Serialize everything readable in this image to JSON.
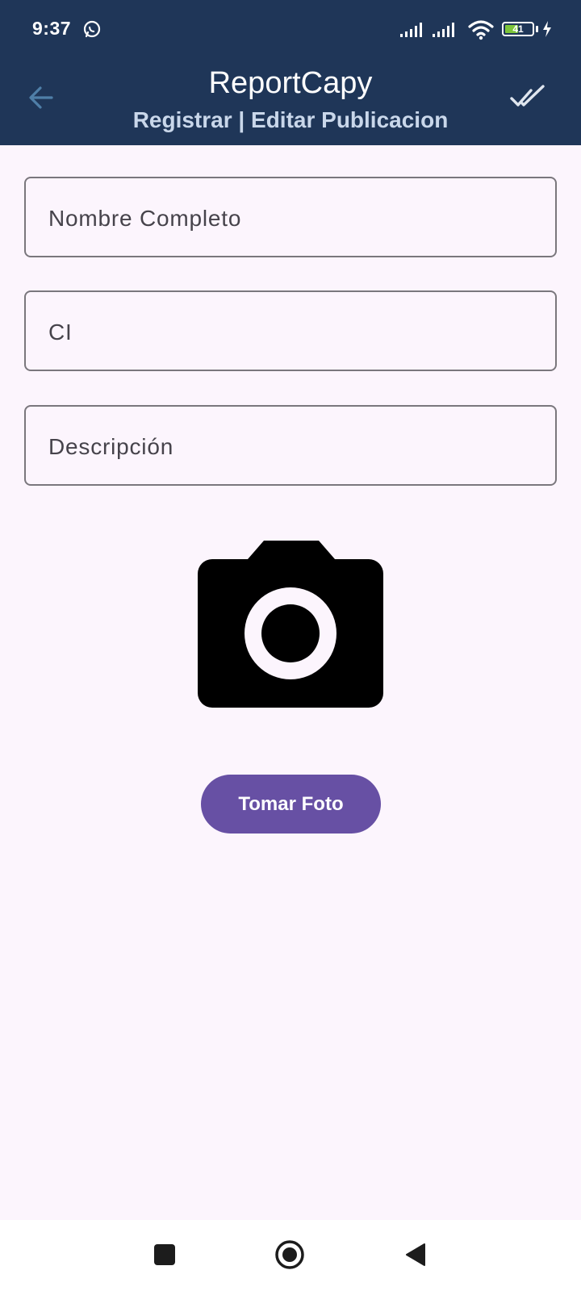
{
  "status_bar": {
    "time": "9:37",
    "battery_level": "41",
    "icons": [
      "whatsapp-icon",
      "signal-icon",
      "signal-icon",
      "wifi-icon",
      "battery-icon",
      "charging-bolt-icon"
    ]
  },
  "app_bar": {
    "title": "ReportCapy",
    "subtitle": "Registrar | Editar Publicacion",
    "back_icon": "arrow-left-icon",
    "confirm_icon": "double-check-icon"
  },
  "form": {
    "fields": [
      {
        "label": "Nombre Completo",
        "value": ""
      },
      {
        "label": "CI",
        "value": ""
      },
      {
        "label": "Descripción",
        "value": ""
      }
    ],
    "photo_icon": "camera-icon",
    "photo_button_label": "Tomar Foto"
  },
  "nav_bar": {
    "icons": [
      "recents-square-icon",
      "home-circle-icon",
      "back-triangle-icon"
    ]
  },
  "colors": {
    "app_bar": "#1f3658",
    "background": "#fcf5fd",
    "primary_button": "#6750a4",
    "battery_fill": "#7dc53a"
  }
}
